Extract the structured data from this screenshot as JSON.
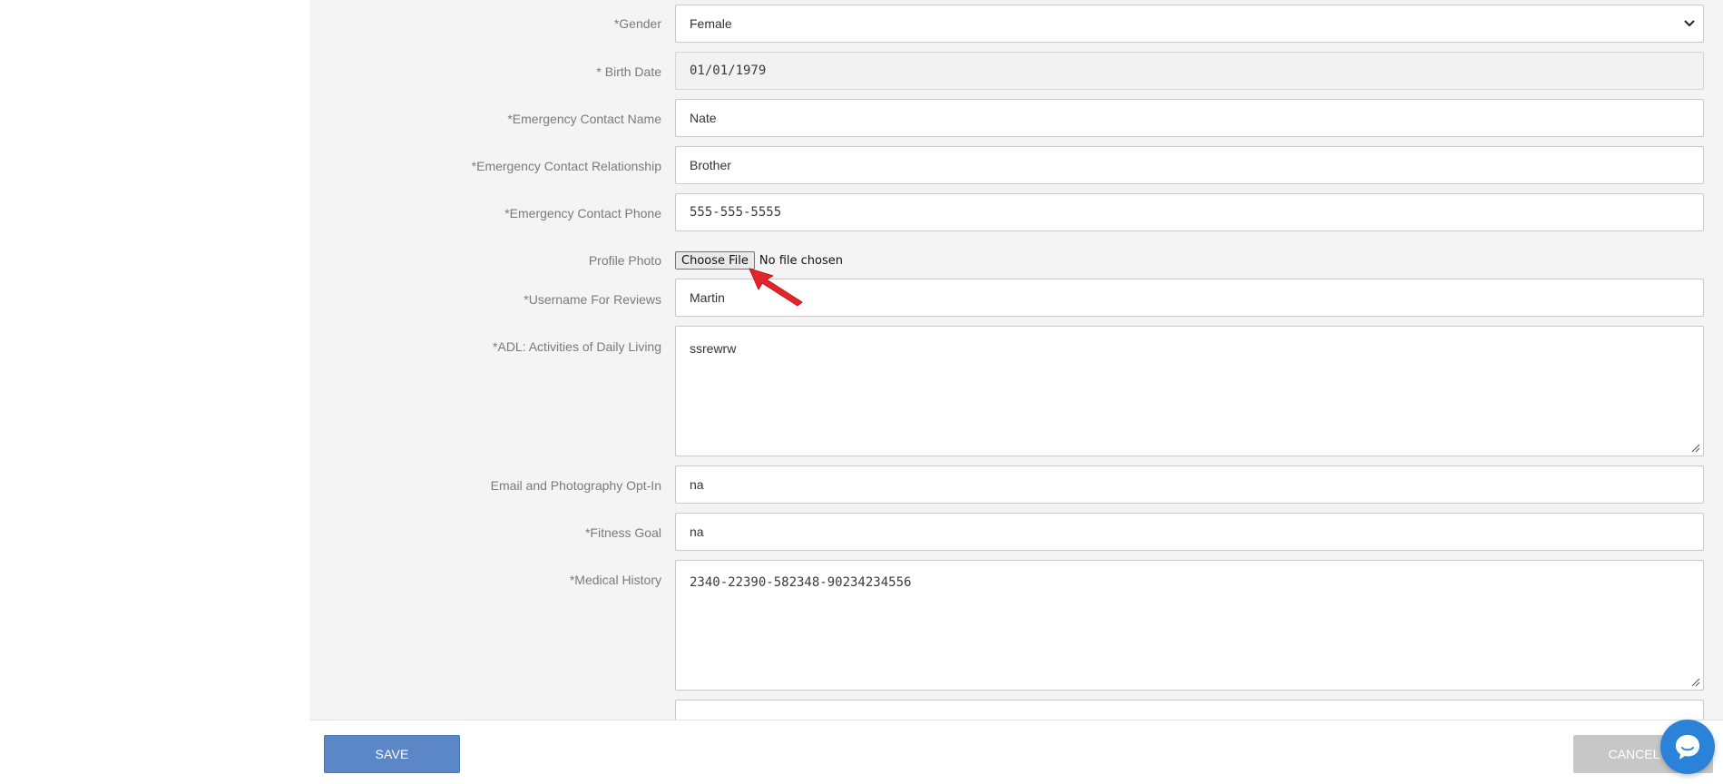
{
  "form": {
    "gender": {
      "label": "*Gender",
      "value": "Female"
    },
    "birth_date": {
      "label": "* Birth Date",
      "value": "01/01/1979"
    },
    "emergency_name": {
      "label": "*Emergency Contact Name",
      "value": "Nate"
    },
    "emergency_relationship": {
      "label": "*Emergency Contact Relationship",
      "value": "Brother"
    },
    "emergency_phone": {
      "label": "*Emergency Contact Phone",
      "value": "555-555-5555"
    },
    "profile_photo": {
      "label": "Profile Photo",
      "button": "Choose File",
      "status": "No file chosen"
    },
    "username": {
      "label": "*Username For Reviews",
      "value": "Martin"
    },
    "adl": {
      "label": "*ADL: Activities of Daily Living",
      "value": "ssrewrw"
    },
    "email_optin": {
      "label": "Email and Photography Opt-In",
      "value": "na"
    },
    "fitness_goal": {
      "label": "*Fitness Goal",
      "value": "na"
    },
    "medical_history": {
      "label": "*Medical History",
      "value": "2340-22390-582348-90234234556"
    }
  },
  "footer": {
    "save_label": "SAVE",
    "cancel_label": "CANCEL"
  },
  "icons": {
    "dropdown": "chevron-down-icon",
    "chat": "chat-bubble-icon",
    "pointer": "red-arrow-icon"
  },
  "colors": {
    "save": "#5b87c7",
    "cancel": "#c7c7c7",
    "chat": "#2a83d9",
    "arrow": "#e3242b"
  }
}
